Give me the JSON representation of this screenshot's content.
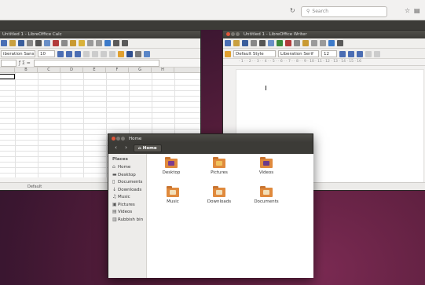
{
  "browser": {
    "search_placeholder": "Search"
  },
  "calc": {
    "title": "Untitled 1 - LibreOffice Calc",
    "font_name": "iberation Sans",
    "font_size": "10",
    "columns": [
      "B",
      "C",
      "D",
      "E",
      "F",
      "G",
      "H"
    ],
    "sheet_tab": "Default"
  },
  "writer": {
    "title": "Untitled 1 - LibreOffice Writer",
    "paragraph_style": "Default Style",
    "font_name": "Liberation Serif",
    "font_size": "12",
    "ruler": "· 1 · · 2 · · 3 · · 4 · · 5 · · 6 · · 7 · · 8 · · 9 · 10 · 11 · 12 · 13 · 14 · 15 · 16"
  },
  "nautilus": {
    "title": "Home",
    "path_button": "Home",
    "places_header": "Places",
    "places": [
      {
        "label": "Home",
        "icon": "home-icon"
      },
      {
        "label": "Desktop",
        "icon": "desktop-icon"
      },
      {
        "label": "Documents",
        "icon": "documents-icon"
      },
      {
        "label": "Downloads",
        "icon": "downloads-icon"
      },
      {
        "label": "Music",
        "icon": "music-icon"
      },
      {
        "label": "Pictures",
        "icon": "pictures-icon"
      },
      {
        "label": "Videos",
        "icon": "videos-icon"
      },
      {
        "label": "Rubbish bin",
        "icon": "trash-icon"
      }
    ],
    "folders": [
      {
        "label": "Desktop",
        "emblem": "#7d3c8f"
      },
      {
        "label": "Pictures",
        "emblem": "#f0c25e"
      },
      {
        "label": "Videos",
        "emblem": "#6c3a8a"
      },
      {
        "label": "Music",
        "emblem": "#f2dfb8"
      },
      {
        "label": "Downloads",
        "emblem": "#f2dfb8"
      },
      {
        "label": "Documents",
        "emblem": "#f2dfb8"
      }
    ]
  },
  "colors": {
    "accent": "#e08a3d",
    "titlebar": "#3c3b37",
    "close": "#e0563a"
  }
}
